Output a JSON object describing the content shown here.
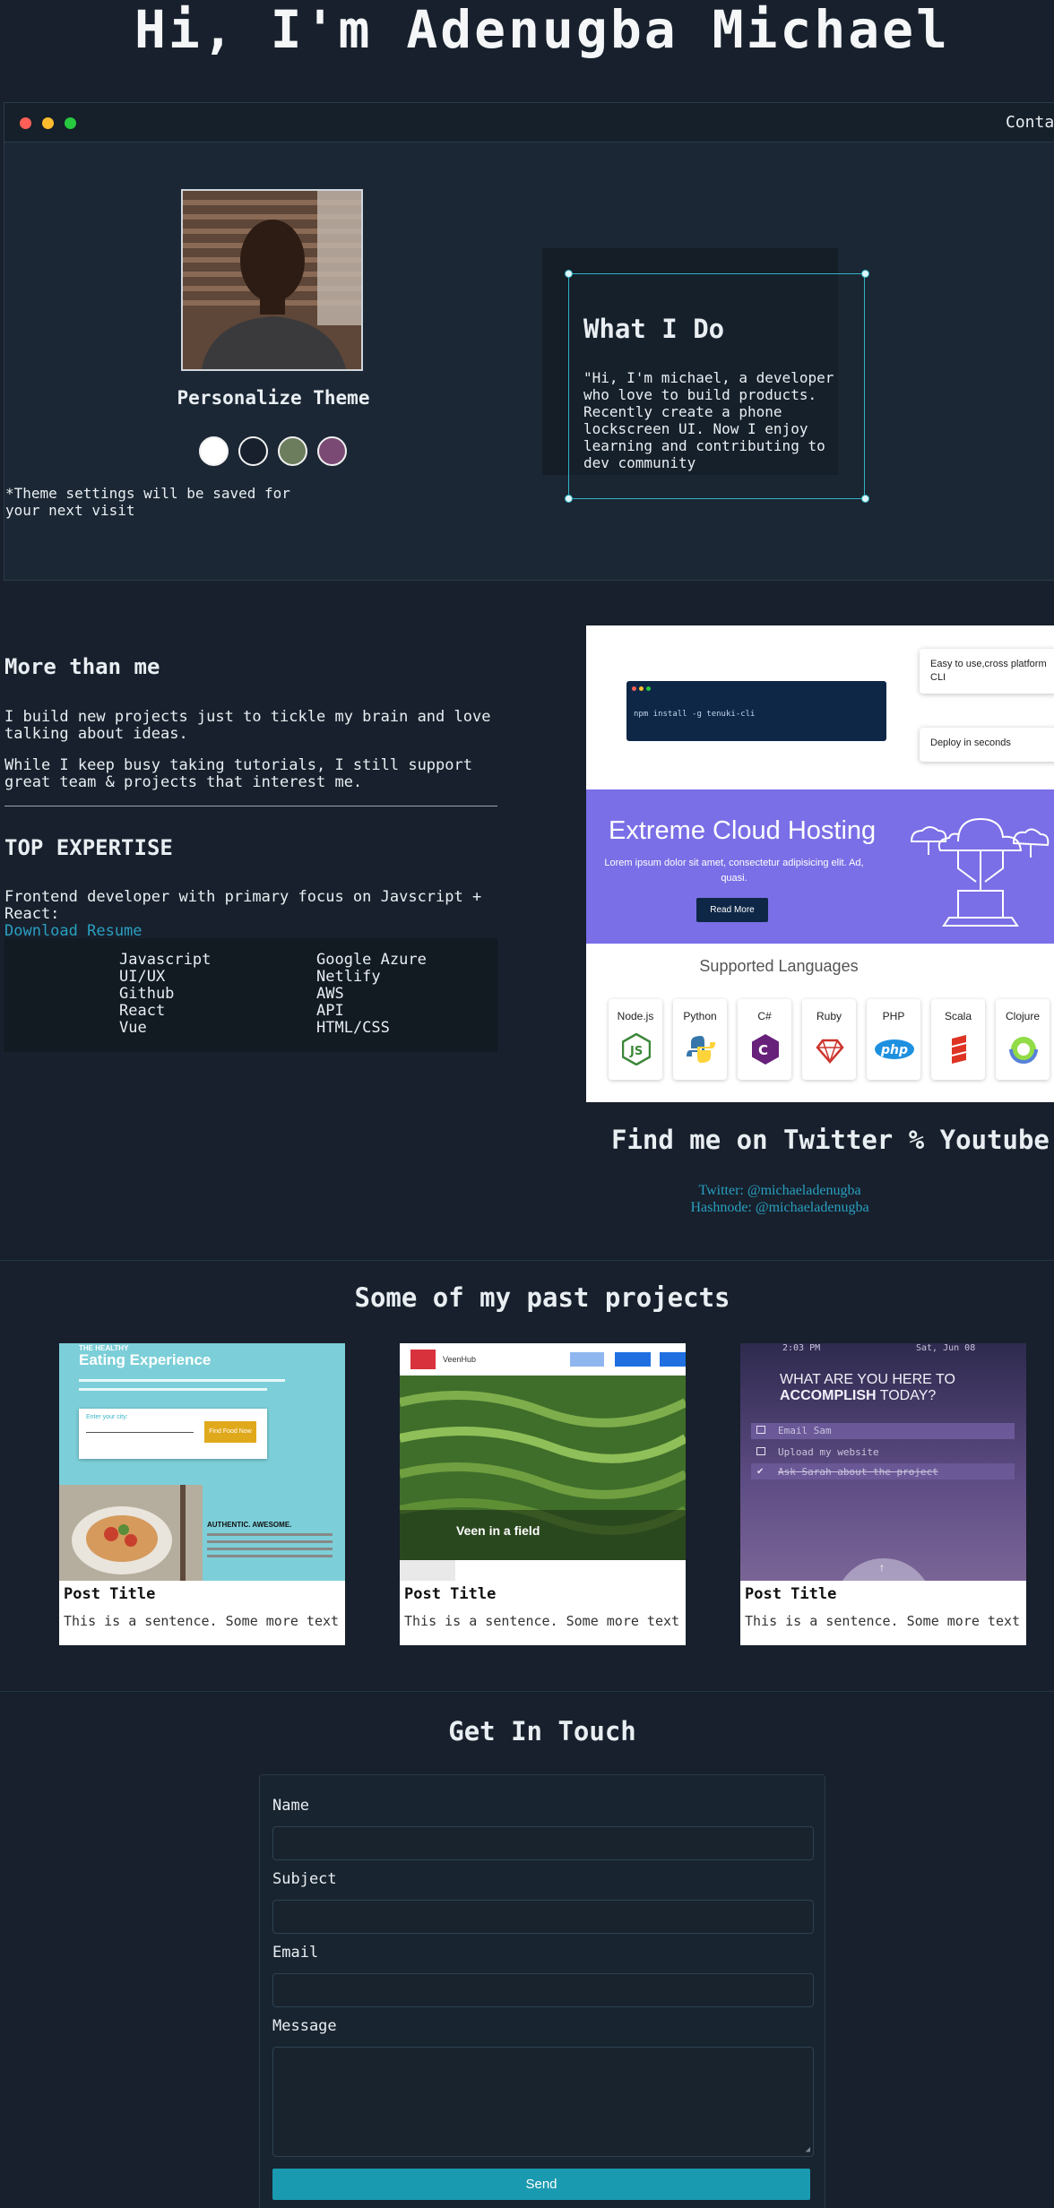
{
  "hero": {
    "title": "Hi, I'm Adenugba Michael"
  },
  "window": {
    "nav_contact": "Contac",
    "theme": {
      "title": "Personalize Theme",
      "note": "*Theme settings will be saved for your next visit",
      "swatches": [
        "#ffffff",
        "#17202c",
        "#6b7d5c",
        "#7a4a74"
      ]
    },
    "whatido": {
      "title": "What I Do",
      "text": "\"Hi, I'm michael, a developer who love to build products. Recently create a phone lockscreen UI. Now I enjoy learning and contributing to dev community"
    }
  },
  "about": {
    "title": "More than me",
    "para1": "I build new projects just to tickle my brain and love talking about ideas.",
    "para2": "While I keep busy taking tutorials, I still support great team & projects that interest me."
  },
  "expertise": {
    "title": "TOP EXPERTISE",
    "line": "Frontend developer with primary focus on Javscript + React:",
    "resume_link": "Download Resume",
    "col1": [
      "Javascript",
      "UI/UX",
      "Github",
      "React",
      "Vue"
    ],
    "col2": [
      "Google Azure",
      "Netlify",
      "AWS",
      "API",
      "HTML/CSS"
    ]
  },
  "hosting": {
    "terminal_cmd": "npm install -g tenuki-cli",
    "feature1": "Easy to use,cross platform CLI",
    "feature2": "Deploy in seconds",
    "cloud_title": "Extreme Cloud Hosting",
    "cloud_sub": "Lorem ipsum dolor sit amet, consectetur adipisicing elit. Ad, quasi.",
    "cloud_btn": "Read More",
    "langs_title": "Supported Languages",
    "langs": [
      "Node.js",
      "Python",
      "C#",
      "Ruby",
      "PHP",
      "Scala",
      "Clojure"
    ]
  },
  "social": {
    "title": "Find me on Twitter % Youtube",
    "twitter": "Twitter: @michaeladenugba",
    "hashnode": "Hashnode: @michaeladenugba"
  },
  "projects": {
    "title": "Some of my past projects",
    "cards": [
      {
        "title": "Post Title",
        "text": "This is a sentence. Some more text",
        "shot_heading_small": "THE HEALTHY",
        "shot_heading": "Eating Experience",
        "shot_field": "Enter your city:",
        "shot_button": "Find Food Now",
        "shot_subhead": "AUTHENTIC. AWESOME."
      },
      {
        "title": "Post Title",
        "text": "This is a sentence. Some more text",
        "shot_brand": "VeenHub",
        "shot_caption": "Veen in a field"
      },
      {
        "title": "Post Title",
        "text": "This is a sentence. Some more text",
        "shot_time": "2:03 PM",
        "shot_date": "Sat, Jun 08",
        "shot_heading": "WHAT ARE YOU HERE TO",
        "shot_heading_bold": "ACCOMPLISH",
        "shot_heading_end": "TODAY?",
        "shot_tasks": [
          "Email Sam",
          "Upload my website",
          "Ask Sarah about the project"
        ]
      }
    ]
  },
  "contact": {
    "title": "Get In Touch",
    "name_label": "Name",
    "subject_label": "Subject",
    "email_label": "Email",
    "message_label": "Message",
    "send_label": "Send"
  }
}
